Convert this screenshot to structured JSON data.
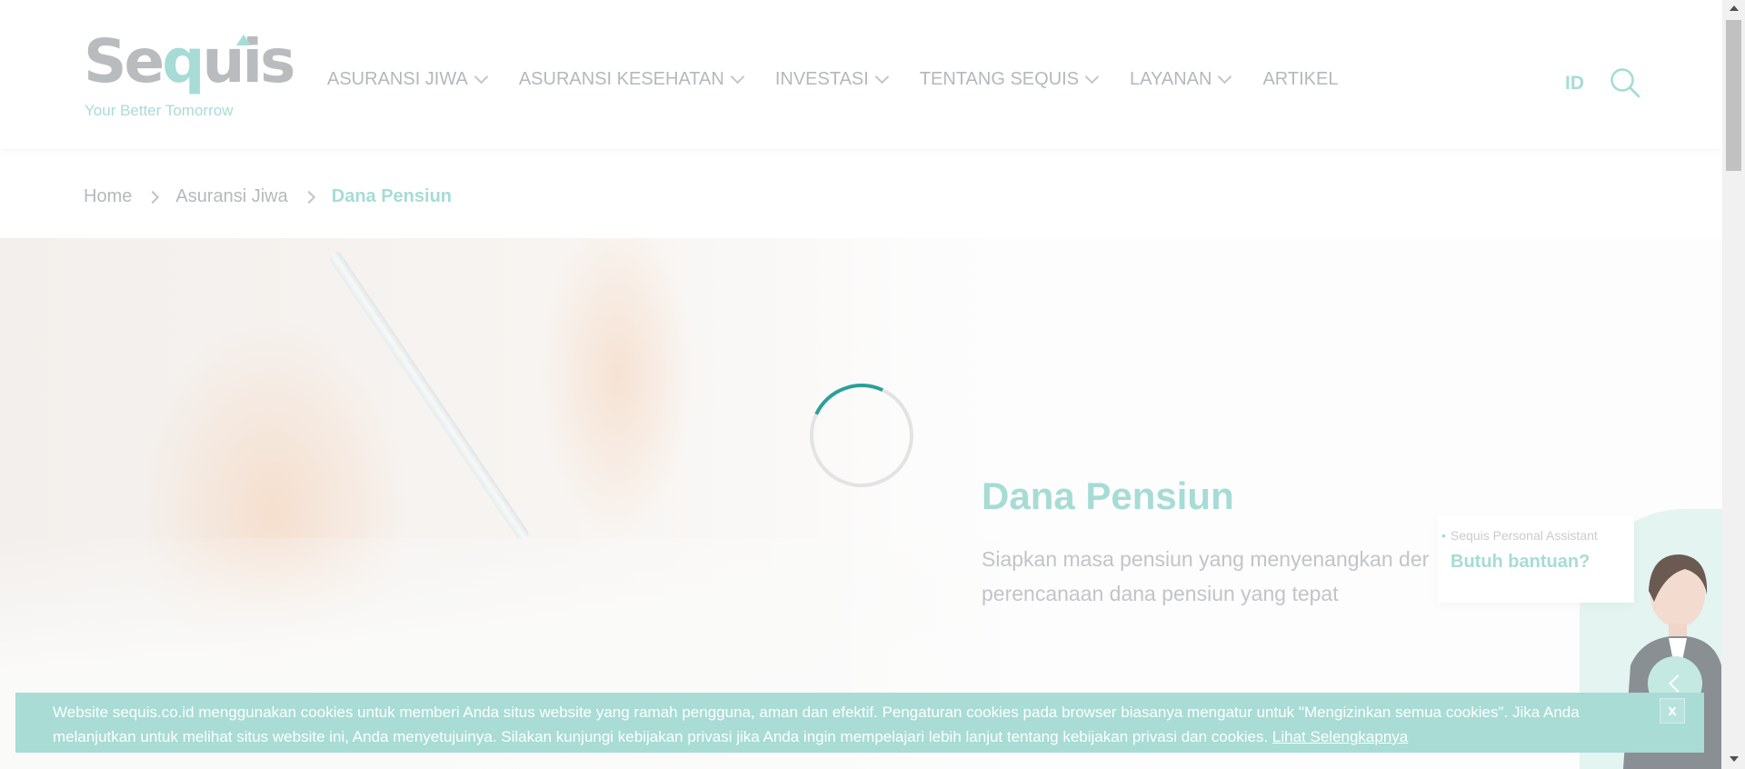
{
  "header": {
    "logo_text": "Sequis",
    "logo_tagline": "Your Better Tomorrow",
    "nav": [
      {
        "label": "ASURANSI JIWA",
        "has_dropdown": true
      },
      {
        "label": "ASURANSI KESEHATAN",
        "has_dropdown": true
      },
      {
        "label": "INVESTASI",
        "has_dropdown": true
      },
      {
        "label": "TENTANG SEQUIS",
        "has_dropdown": true
      },
      {
        "label": "LAYANAN",
        "has_dropdown": true
      },
      {
        "label": "ARTIKEL",
        "has_dropdown": false
      }
    ],
    "language": "ID",
    "search_icon": "search-icon"
  },
  "breadcrumb": {
    "items": [
      "Home",
      "Asuransi Jiwa"
    ],
    "current": "Dana Pensiun"
  },
  "hero": {
    "title": "Dana Pensiun",
    "subtitle_line1": "Siapkan masa pensiun yang menyenangkan der",
    "subtitle_line2": "perencanaan dana pensiun yang tepat"
  },
  "assistant": {
    "label": "Sequis Personal Assistant",
    "help": "Butuh bantuan?"
  },
  "cookie": {
    "text": "Website sequis.co.id menggunakan cookies untuk memberi Anda situs website yang ramah pengguna, aman dan efektif. Pengaturan cookies pada browser biasanya mengatur untuk \"Mengizinkan semua cookies\". Jika Anda melanjutkan untuk melihat situs website ini, Anda menyetujuinya. Silakan kunjungi kebijakan privasi jika Anda ingin mempelajari lebih lanjut tentang kebijakan privasi dan cookies.",
    "link": "Lihat Selengkapnya",
    "close": "x"
  },
  "colors": {
    "brand_teal": "#a6dcd5",
    "spinner": "#2aa198",
    "nav_text": "#b5b8ba"
  }
}
